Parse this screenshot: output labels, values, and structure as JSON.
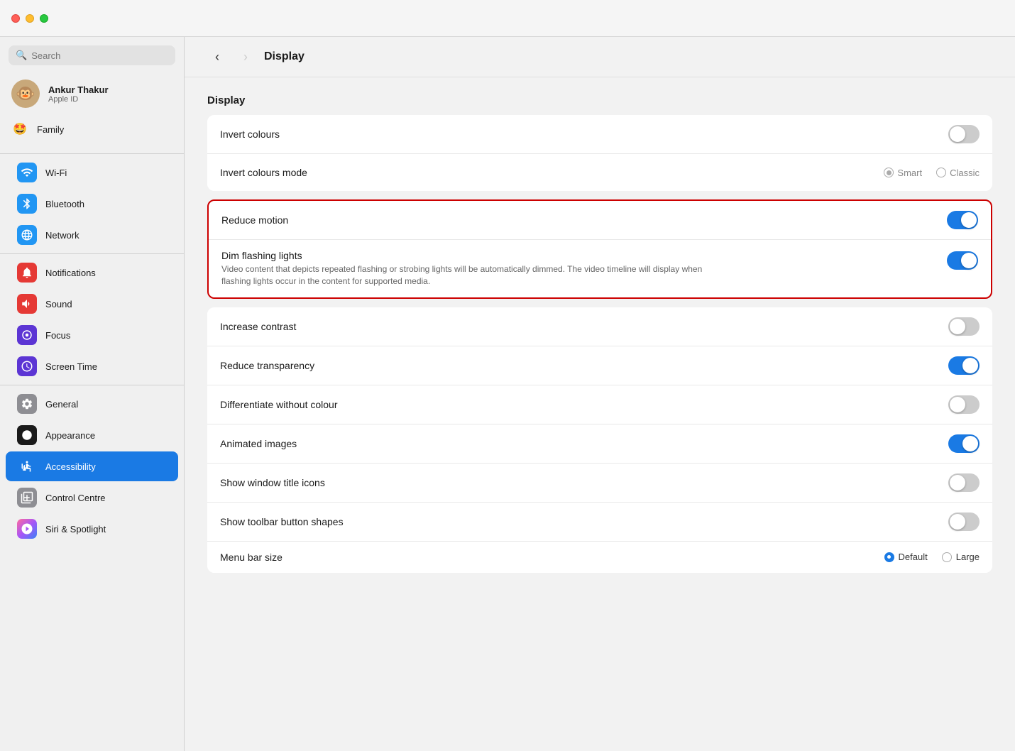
{
  "titleBar": {
    "trafficLights": [
      "close",
      "minimize",
      "maximize"
    ]
  },
  "sidebar": {
    "search": {
      "placeholder": "Search"
    },
    "user": {
      "name": "Ankur Thakur",
      "subtitle": "Apple ID",
      "avatar": "🐵"
    },
    "family": {
      "label": "Family",
      "avatar": "🤩"
    },
    "items": [
      {
        "id": "wifi",
        "label": "Wi-Fi",
        "icon": "wifi",
        "color": "#2196f3",
        "active": false
      },
      {
        "id": "bluetooth",
        "label": "Bluetooth",
        "icon": "bluetooth",
        "color": "#2196f3",
        "active": false
      },
      {
        "id": "network",
        "label": "Network",
        "icon": "network",
        "color": "#2196f3",
        "active": false
      },
      {
        "id": "notifications",
        "label": "Notifications",
        "icon": "notifications",
        "color": "#e53935",
        "active": false
      },
      {
        "id": "sound",
        "label": "Sound",
        "icon": "sound",
        "color": "#e53935",
        "active": false
      },
      {
        "id": "focus",
        "label": "Focus",
        "icon": "focus",
        "color": "#5c35d4",
        "active": false
      },
      {
        "id": "screen-time",
        "label": "Screen Time",
        "icon": "screen-time",
        "color": "#5c35d4",
        "active": false
      },
      {
        "id": "general",
        "label": "General",
        "icon": "general",
        "color": "#8e8e93",
        "active": false
      },
      {
        "id": "appearance",
        "label": "Appearance",
        "icon": "appearance",
        "color": "#1a1a1a",
        "active": false
      },
      {
        "id": "accessibility",
        "label": "Accessibility",
        "icon": "accessibility",
        "color": "#1a7ae4",
        "active": true
      },
      {
        "id": "control-centre",
        "label": "Control Centre",
        "icon": "control-centre",
        "color": "#8e8e93",
        "active": false
      },
      {
        "id": "siri-spotlight",
        "label": "Siri & Spotlight",
        "icon": "siri",
        "color": "#8e8e93",
        "active": false
      }
    ]
  },
  "header": {
    "title": "Display",
    "backEnabled": true,
    "forwardEnabled": false
  },
  "content": {
    "sectionTitle": "Display",
    "settings": [
      {
        "id": "invert-colours",
        "label": "Invert colours",
        "type": "toggle",
        "value": false,
        "highlighted": false
      },
      {
        "id": "invert-colours-mode",
        "label": "Invert colours mode",
        "type": "radio",
        "options": [
          "Smart",
          "Classic"
        ],
        "selected": "Smart",
        "highlighted": false
      },
      {
        "id": "reduce-motion",
        "label": "Reduce motion",
        "type": "toggle",
        "value": true,
        "highlighted": true
      },
      {
        "id": "dim-flashing-lights",
        "label": "Dim flashing lights",
        "desc": "Video content that depicts repeated flashing or strobing lights will be automatically dimmed. The video timeline will display when flashing lights occur in the content for supported media.",
        "type": "toggle",
        "value": true,
        "highlighted": true
      },
      {
        "id": "increase-contrast",
        "label": "Increase contrast",
        "type": "toggle",
        "value": false,
        "highlighted": false
      },
      {
        "id": "reduce-transparency",
        "label": "Reduce transparency",
        "type": "toggle",
        "value": true,
        "highlighted": false
      },
      {
        "id": "differentiate-without-colour",
        "label": "Differentiate without colour",
        "type": "toggle",
        "value": false,
        "highlighted": false
      },
      {
        "id": "animated-images",
        "label": "Animated images",
        "type": "toggle",
        "value": true,
        "highlighted": false
      },
      {
        "id": "show-window-title-icons",
        "label": "Show window title icons",
        "type": "toggle",
        "value": false,
        "highlighted": false
      },
      {
        "id": "show-toolbar-button-shapes",
        "label": "Show toolbar button shapes",
        "type": "toggle",
        "value": false,
        "highlighted": false
      },
      {
        "id": "menu-bar-size",
        "label": "Menu bar size",
        "type": "radio-blue",
        "options": [
          "Default",
          "Large"
        ],
        "selected": "Default",
        "highlighted": false
      }
    ]
  }
}
